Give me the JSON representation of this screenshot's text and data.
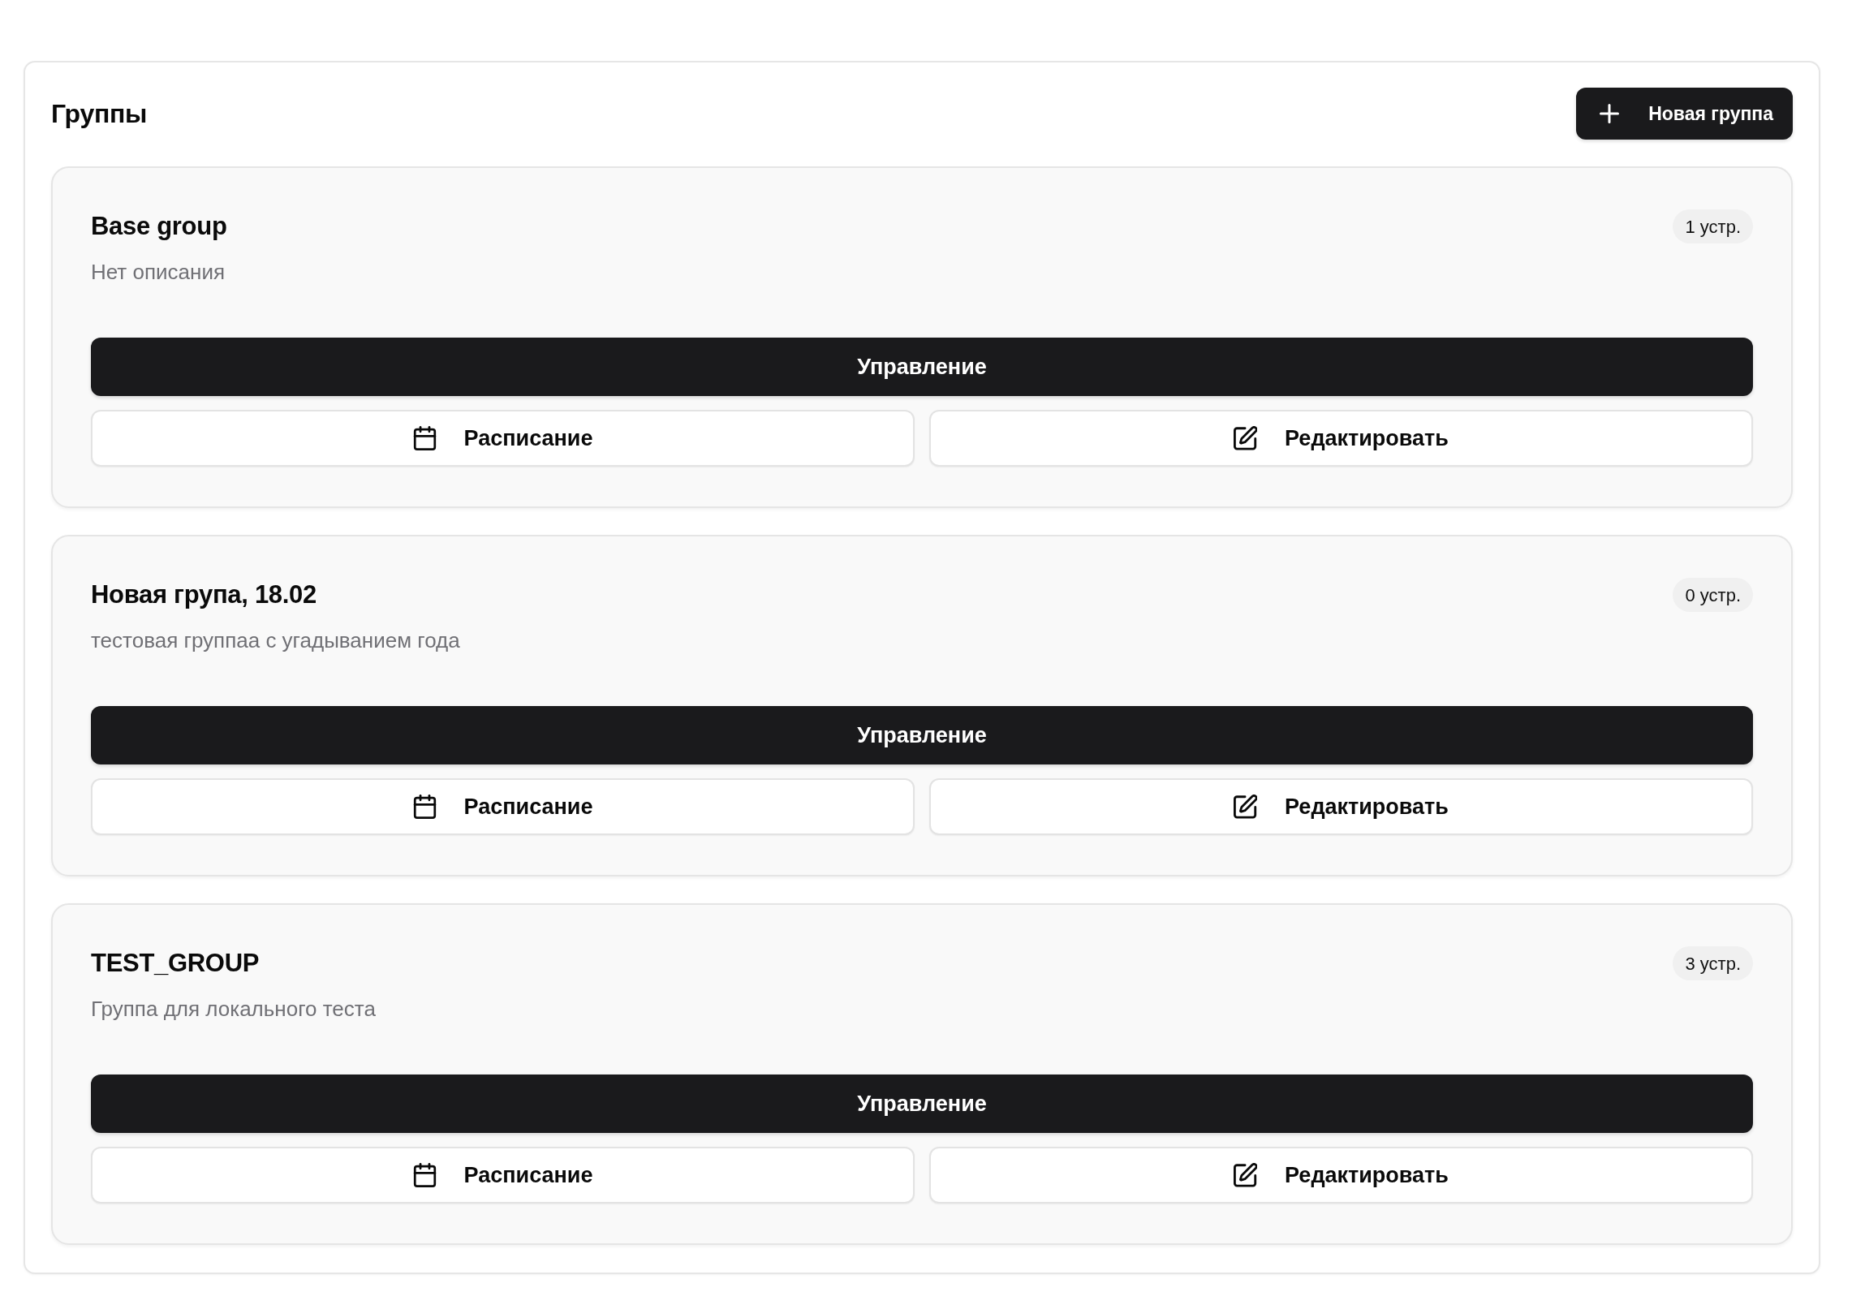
{
  "header": {
    "title": "Группы",
    "new_button": {
      "label": "Новая группа"
    }
  },
  "groups": [
    {
      "name": "Base group",
      "device_count": "1 устр.",
      "description": "Нет описания",
      "actions": [
        {
          "kind": "primary",
          "label": "Управление"
        },
        {
          "kind": "schedule",
          "label": "Расписание"
        },
        {
          "kind": "edit",
          "label": "Редактировать"
        }
      ]
    },
    {
      "name": "Новая група, 18.02",
      "device_count": "0 устр.",
      "description": "тестовая группаа с угадыванием года",
      "actions": [
        {
          "kind": "primary",
          "label": "Управление"
        },
        {
          "kind": "schedule",
          "label": "Расписание"
        },
        {
          "kind": "edit",
          "label": "Редактировать"
        }
      ]
    },
    {
      "name": "TEST_GROUP",
      "device_count": "3 устр.",
      "description": "Группа для локального теста",
      "actions": [
        {
          "kind": "primary",
          "label": "Управление"
        },
        {
          "kind": "schedule",
          "label": "Расписание"
        },
        {
          "kind": "edit",
          "label": "Редактировать"
        }
      ]
    }
  ]
}
